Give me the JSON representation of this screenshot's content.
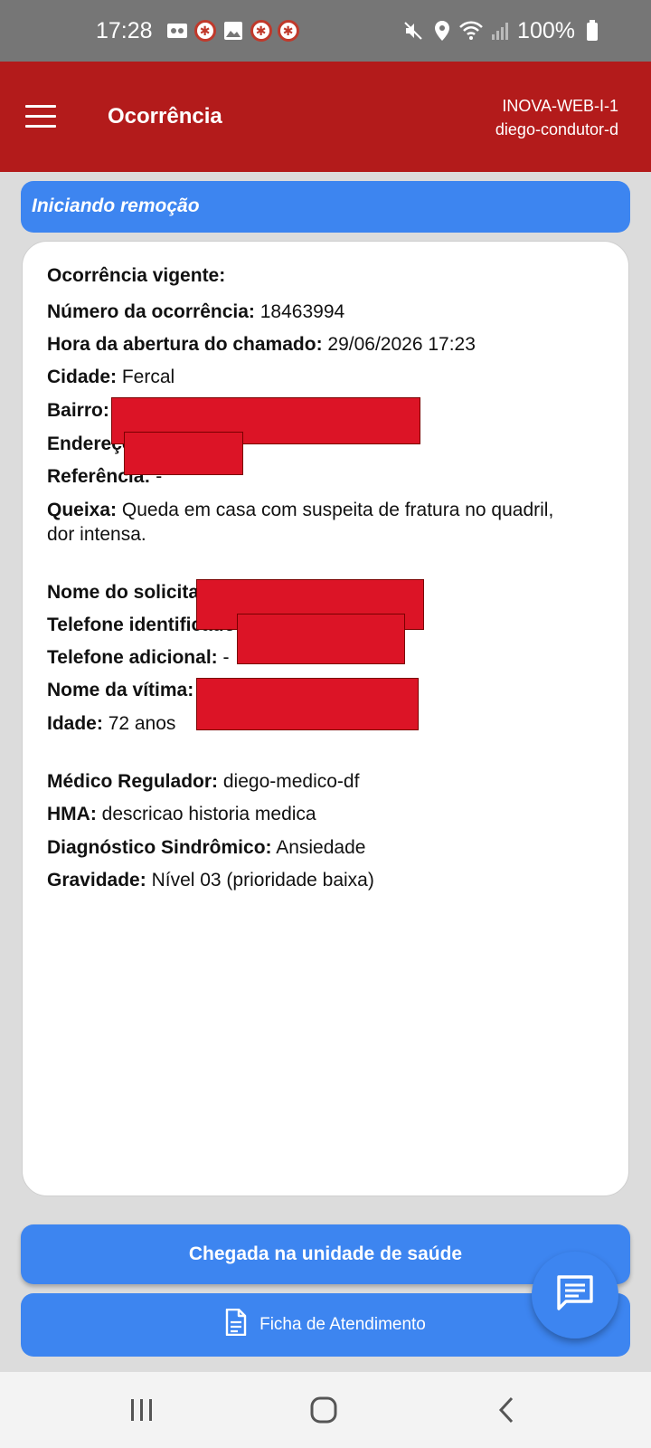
{
  "status_bar": {
    "time": "17:28",
    "battery": "100%",
    "left_icons": [
      "voicemail-icon",
      "samu-icon",
      "gallery-icon",
      "samu-icon",
      "samu-icon"
    ],
    "right_icons": [
      "mute-icon",
      "location-icon",
      "wifi-icon",
      "signal-icon",
      "battery-icon"
    ]
  },
  "app_bar": {
    "title": "Ocorrência",
    "user_line1": "INOVA-WEB-I-1",
    "user_line2": "diego-condutor-d"
  },
  "banner": {
    "text": "Iniciando remoção"
  },
  "occurrence": {
    "heading": "Ocorrência vigente:",
    "fields": [
      {
        "label": "Número da ocorrência:",
        "value": "18463994"
      },
      {
        "label": "Hora da abertura do chamado:",
        "value": "29/06/2026 17:23"
      },
      {
        "label": "Cidade:",
        "value": "Fercal"
      },
      {
        "label": "Bairro:",
        "value": ""
      },
      {
        "label": "Endereço",
        "value": ""
      },
      {
        "label": "Referência:",
        "value": "-"
      },
      {
        "label": "Queixa:",
        "value": "Queda em casa com suspeita de fratura no quadril,"
      },
      {
        "label": "",
        "value": "dor intensa."
      },
      {
        "label": "Nome do solicita",
        "value": ""
      },
      {
        "label": "Telefone identificado",
        "value": ""
      },
      {
        "label": "Telefone adicional:",
        "value": "-"
      },
      {
        "label": "Nome da vítima:",
        "value": ""
      },
      {
        "label": "Idade:",
        "value": "72 anos"
      },
      {
        "label": "Médico Regulador:",
        "value": "diego-medico-df"
      },
      {
        "label": "HMA:",
        "value": "descricao historia medica"
      },
      {
        "label": "Diagnóstico Sindrômico:",
        "value": "Ansiedade"
      },
      {
        "label": "Gravidade:",
        "value": "Nível 03 (prioridade baixa)"
      }
    ]
  },
  "actions": {
    "arrival_button": "Chegada na unidade de saúde",
    "form_button": "Ficha de Atendimento"
  },
  "colors": {
    "app_bar": "#b31b1b",
    "primary": "#3d85f0",
    "redaction": "#dc1426"
  }
}
